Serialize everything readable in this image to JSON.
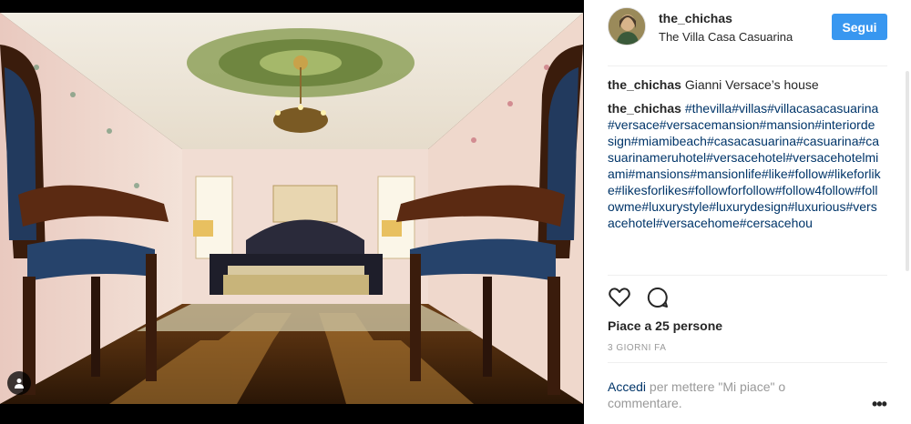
{
  "post": {
    "username": "the_chichas",
    "location": "The Villa Casa Casuarina",
    "follow_label": "Segui",
    "caption_user": "the_chichas",
    "caption_text": "Gianni Versace’s house",
    "hashtags_user": "the_chichas",
    "hashtags_text": "#thevilla#villas#villacasacasuarina #versace#versacemansion#mansion#interiordesign#miamibeach#casacasuarina#casuarina#casuarinameruhotel#versacehotel#versacehotelmiami#mansions#mansionlife#like#follow#likeforlike#likesforlikes#followforfollow#follow4follow#followme#luxurystyle#luxurydesign#luxurious#versacehotel#versacehome#cersacehou",
    "likes_label": "Piace a 25 persone",
    "time_label": "3 GIORNI FA",
    "login_link": "Accedi",
    "login_rest": " per mettere \"Mi piace\" o commentare.",
    "more_label": "•••"
  },
  "icons": {
    "like": "heart-icon",
    "comment": "comment-icon",
    "user_tag": "user-tag-icon"
  },
  "colors": {
    "follow_bg": "#3897f0",
    "link": "#003569",
    "muted": "#999999"
  }
}
